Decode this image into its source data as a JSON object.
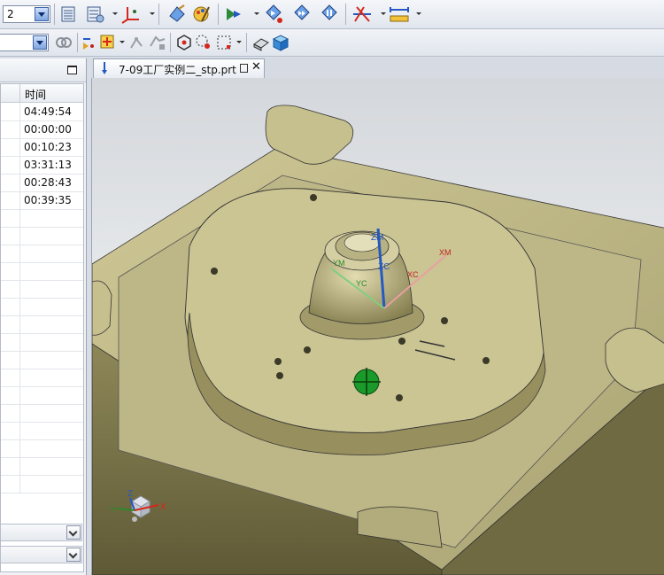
{
  "toolbar": {
    "layer_combo_value": "2",
    "row1_icons": [
      "layers-icon",
      "layer-settings-icon",
      "datum-csys-icon",
      "edit-object-icon",
      "paint-brush-icon",
      "view-play-icon",
      "view-forward-icon",
      "view-step-icon",
      "view-reset-icon",
      "measure-distance-icon",
      "measure-length-icon"
    ],
    "row2_icons": [
      "filter-combo",
      "link-icon",
      "snap-icon",
      "select-point-icon",
      "point-on-curve-icon",
      "feature-icon",
      "select-all-icon",
      "box-select-icon",
      "shaded-view-icon",
      "solid-cube-icon"
    ],
    "filter_combo_value": ""
  },
  "left_panel": {
    "column_header": "时间",
    "rows": [
      "04:49:54",
      "00:00:00",
      "00:10:23",
      "03:31:13",
      "00:28:43",
      "00:39:35",
      "",
      "",
      "",
      "",
      "",
      "",
      "",
      "",
      "",
      "",
      "",
      "",
      "",
      "",
      "",
      ""
    ],
    "colors": {
      "panel_bg": "#f0f2f5",
      "header_bg": "#e9edf2"
    }
  },
  "document_tab": {
    "title": "7-09工厂实例二_stp.prt",
    "close_glyph": "✕"
  },
  "viewport": {
    "model_color": "#bdb686",
    "csys_labels": {
      "zm": "ZM",
      "zc": "ZC",
      "ym": "YM",
      "yc": "YC",
      "xm": "XM",
      "xc": "XC"
    },
    "triad_labels": {
      "x": "X",
      "y": "Y",
      "z": "Z"
    }
  }
}
